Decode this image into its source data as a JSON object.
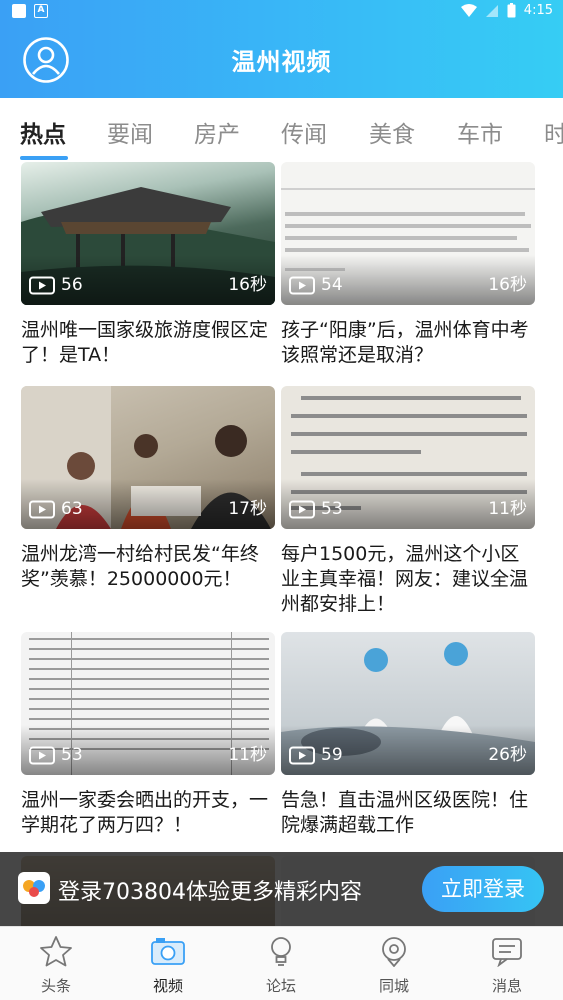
{
  "statusbar": {
    "time": "4:15"
  },
  "header": {
    "title": "温州视频"
  },
  "tabs": [
    "热点",
    "要闻",
    "房产",
    "传闻",
    "美食",
    "车市",
    "时"
  ],
  "active_tab": "热点",
  "videos": [
    {
      "title": "温州唯一国家级旅游度假区定了！是TA！",
      "views": "56",
      "duration": "16秒"
    },
    {
      "title": "孩子“阳康”后，温州体育中考该照常还是取消？",
      "views": "54",
      "duration": "16秒"
    },
    {
      "title": "温州龙湾一村给村民发“年终奖”羡慕！25000000元！",
      "views": "63",
      "duration": "17秒"
    },
    {
      "title": "每户1500元，温州这个小区业主真幸福！网友：建议全温州都安排上！",
      "views": "53",
      "duration": "11秒"
    },
    {
      "title": "温州一家委会晒出的开支，一学期花了两万四？！",
      "views": "53",
      "duration": "11秒"
    },
    {
      "title": "告急！直击温州区级医院！住院爆满超载工作",
      "views": "59",
      "duration": "26秒"
    }
  ],
  "banner": {
    "text": "登录703804体验更多精彩内容",
    "button": "立即登录"
  },
  "nav": [
    {
      "label": "头条",
      "icon": "star-icon"
    },
    {
      "label": "视频",
      "icon": "camera-icon"
    },
    {
      "label": "论坛",
      "icon": "bulb-icon"
    },
    {
      "label": "同城",
      "icon": "location-icon"
    },
    {
      "label": "消息",
      "icon": "message-icon"
    }
  ],
  "active_nav": "视频",
  "colors": {
    "brand": "#3aa0f5",
    "brand_light": "#36cdf4"
  }
}
